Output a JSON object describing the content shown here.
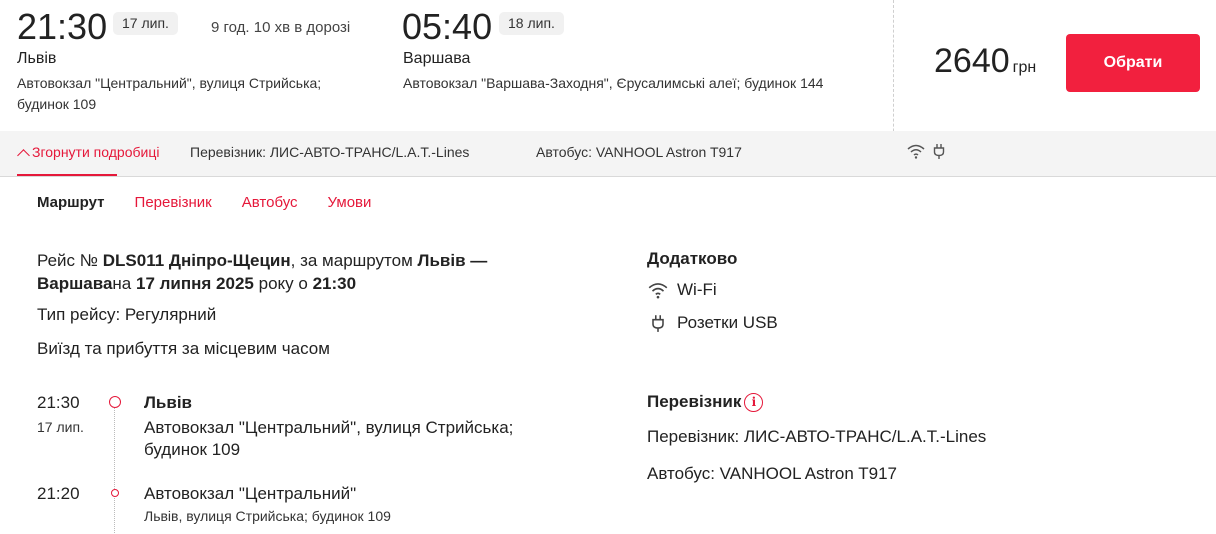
{
  "trip": {
    "departure": {
      "time": "21:30",
      "date": "17 лип.",
      "city": "Львів",
      "station": "Автовокзал \"Центральний\", вулиця Стрийська; будинок 109"
    },
    "duration": "9 год. 10 хв в дорозі",
    "arrival": {
      "time": "05:40",
      "date": "18 лип.",
      "city": "Варшава",
      "station": "Автовокзал \"Варшава-Заходня\", Єрусалимські алеї; будинок 144"
    },
    "price": {
      "amount": "2640",
      "currency": "грн"
    },
    "choose_label": "Обрати"
  },
  "details_bar": {
    "collapse_label": "Згорнути подробиці",
    "carrier_text": "Перевізник: ЛИС-АВТО-ТРАНС/L.A.T.-Lines",
    "bus_text": "Автобус: VANHOOL Astron T917",
    "icons": [
      "wifi-icon",
      "usb-plug-icon"
    ]
  },
  "tabs": [
    "Маршрут",
    "Перевізник",
    "Автобус",
    "Умови"
  ],
  "route": {
    "prefix": "Рейс № ",
    "flight": "DLS011 Дніпро-Щецин",
    "mid": ", за маршрутом ",
    "route_name": "Львів — Варшава",
    "on": "на ",
    "date_bold": "17 липня 2025",
    "year_at": " року о ",
    "time_bold": "21:30",
    "trip_type": "Тип рейсу: Регулярний",
    "local_time": "Виїзд та прибуття за місцевим часом"
  },
  "stops": [
    {
      "time": "21:30",
      "date": "17 лип.",
      "city": "Львів",
      "address": "Автовокзал \"Центральний\", вулиця Стрийська; будинок 109"
    },
    {
      "time": "21:20",
      "name": "Автовокзал \"Центральний\"",
      "address": "Львів, вулиця Стрийська; будинок 109"
    }
  ],
  "extras": {
    "title": "Додатково",
    "items": [
      "Wi-Fi",
      "Розетки USB"
    ]
  },
  "carrier_info": {
    "title": "Перевізник",
    "info_icon_glyph": "i",
    "carrier_line": "Перевізник: ЛИС-АВТО-ТРАНС/L.A.T.-Lines",
    "bus_line": "Автобус: VANHOOL Astron T917"
  },
  "colors": {
    "accent": "#e5183a",
    "button": "#f2203e",
    "bar_background": "#f4f4f4",
    "badge_background": "#f1f1f1"
  }
}
